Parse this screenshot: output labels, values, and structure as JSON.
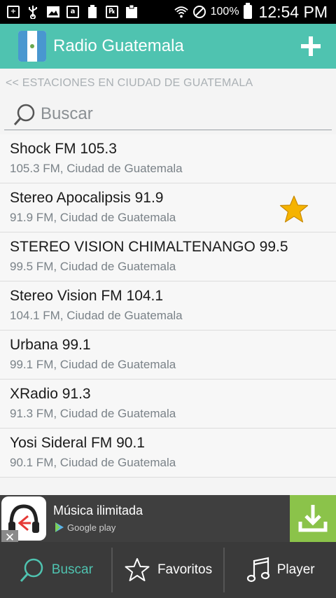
{
  "status_bar": {
    "battery_percent": "100%",
    "time": "12:54 PM",
    "icons": [
      "add-box-icon",
      "usb-icon",
      "image-icon",
      "amazon-icon",
      "battery-100-icon",
      "rx-icon",
      "clipboard-icon",
      "wifi-icon",
      "do-not-disturb-icon",
      "battery-icon"
    ]
  },
  "app_bar": {
    "title": "Radio Guatemala",
    "icon": "guatemala-flag",
    "action_icon": "plus-icon"
  },
  "breadcrumb": "<< ESTACIONES EN CIUDAD DE GUATEMALA",
  "search": {
    "placeholder": "Buscar",
    "value": ""
  },
  "stations": [
    {
      "name": "Shock FM 105.3",
      "detail": "105.3 FM, Ciudad de Guatemala",
      "favorite": false
    },
    {
      "name": "Stereo Apocalipsis 91.9",
      "detail": "91.9 FM, Ciudad de Guatemala",
      "favorite": true
    },
    {
      "name": "STEREO VISION CHIMALTENANGO 99.5",
      "detail": "99.5 FM, Ciudad de Guatemala",
      "favorite": false
    },
    {
      "name": "Stereo Vision FM 104.1",
      "detail": "104.1 FM, Ciudad de Guatemala",
      "favorite": false
    },
    {
      "name": "Urbana 99.1",
      "detail": "99.1 FM, Ciudad de Guatemala",
      "favorite": false
    },
    {
      "name": "XRadio 91.3",
      "detail": "91.3 FM, Ciudad de Guatemala",
      "favorite": false
    },
    {
      "name": "Yosi Sideral FM 90.1",
      "detail": "90.1 FM, Ciudad de Guatemala",
      "favorite": false
    }
  ],
  "ad": {
    "title": "Música ilimitada",
    "store": "Google play",
    "close": "✕",
    "accent": "#8bc34a"
  },
  "bottom_nav": [
    {
      "label": "Buscar",
      "icon": "search-icon",
      "active": true
    },
    {
      "label": "Favoritos",
      "icon": "star-icon",
      "active": false
    },
    {
      "label": "Player",
      "icon": "music-note-icon",
      "active": false
    }
  ],
  "colors": {
    "primary": "#4fc3b0",
    "star": "#f5b300"
  }
}
